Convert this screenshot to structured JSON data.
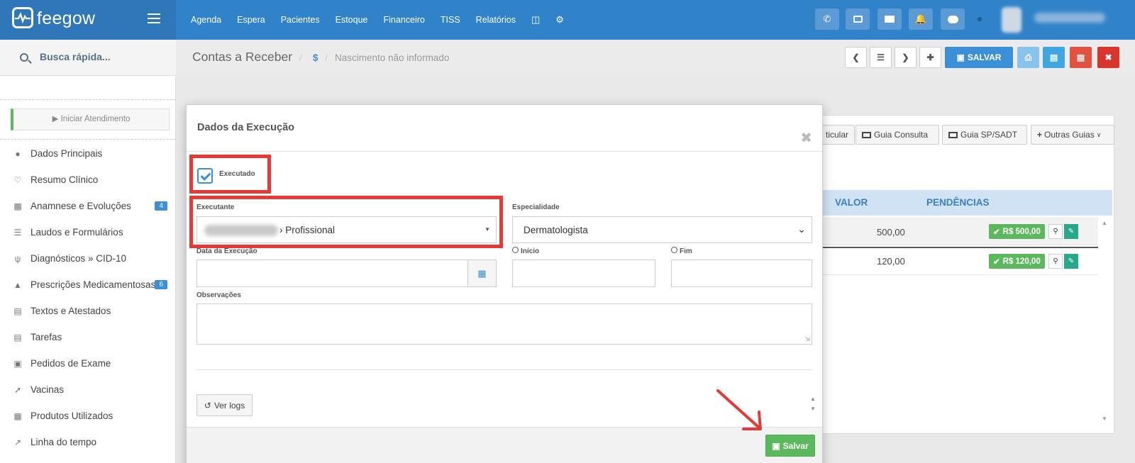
{
  "app": {
    "logo": "feegow"
  },
  "nav": [
    "Agenda",
    "Espera",
    "Pacientes",
    "Estoque",
    "Financeiro",
    "TISS",
    "Relatórios"
  ],
  "search": {
    "placeholder": "Busca rápida..."
  },
  "sidebar": {
    "start_button": "▶ Iniciar Atendimento",
    "items": [
      {
        "label": "Dados Principais",
        "icon": "user-icon"
      },
      {
        "label": "Resumo Clínico",
        "icon": "heart-icon"
      },
      {
        "label": "Anamnese e Evoluções",
        "icon": "bar-chart-icon",
        "badge": "4"
      },
      {
        "label": "Laudos e Formulários",
        "icon": "list-icon"
      },
      {
        "label": "Diagnósticos » CID-10",
        "icon": "stethoscope-icon"
      },
      {
        "label": "Prescrições Medicamentosas",
        "icon": "flask-icon",
        "badge": "6"
      },
      {
        "label": "Textos e Atestados",
        "icon": "document-icon"
      },
      {
        "label": "Tarefas",
        "icon": "document-icon"
      },
      {
        "label": "Pedidos de Exame",
        "icon": "clipboard-icon"
      },
      {
        "label": "Vacinas",
        "icon": "syringe-icon"
      },
      {
        "label": "Produtos Utilizados",
        "icon": "briefcase-icon"
      },
      {
        "label": "Linha do tempo",
        "icon": "line-chart-icon"
      }
    ]
  },
  "header": {
    "title": "Contas a Receber",
    "currency_symbol": "$",
    "subtitle": "Nascimento não informado",
    "save_label": "SALVAR"
  },
  "background": {
    "guide_buttons": [
      "ticular",
      "Guia Consulta",
      "Guia SP/SADT",
      "Outras Guias"
    ],
    "columns": [
      "VALOR",
      "PENDÊNCIAS"
    ],
    "rows": [
      {
        "valor": "500,00",
        "pendencia": "R$ 500,00"
      },
      {
        "valor": "120,00",
        "pendencia": "R$ 120,00"
      }
    ]
  },
  "modal": {
    "title": "Dados da Execução",
    "executado_label": "Executado",
    "executado_checked": true,
    "executante_label": "Executante",
    "executante_value": "› Profissional",
    "especialidade_label": "Especialidade",
    "especialidade_value": "Dermatologista",
    "data_label": "Data da Execução",
    "inicio_label": "Início",
    "fim_label": "Fim",
    "obs_label": "Observações",
    "logs_button": "Ver logs",
    "save_button": "Salvar"
  },
  "colors": {
    "primary": "#3183c9",
    "success": "#5cb85c",
    "highlight": "#e53935"
  }
}
